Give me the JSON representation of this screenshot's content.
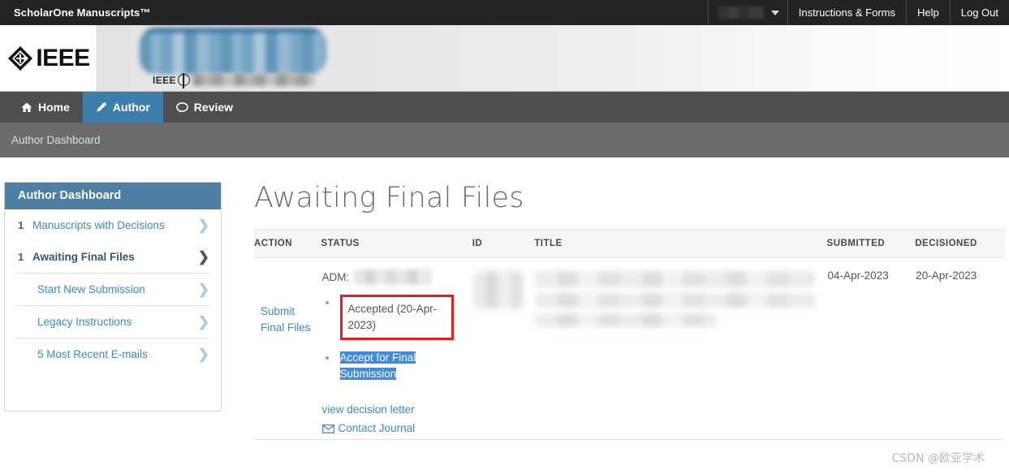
{
  "topbar": {
    "product_title": "ScholarOne Manuscripts™",
    "user_menu_label": "",
    "caret_icon": "chevron-down-icon",
    "links": [
      {
        "label": "Instructions & Forms"
      },
      {
        "label": "Help"
      },
      {
        "label": "Log Out"
      }
    ]
  },
  "banner": {
    "ieee_logo_text": "IEEE",
    "ieee_diamond_icon": "ieee-diamond-icon",
    "journal_logo_alt": "journal-logo-redacted",
    "journal_sub_text": "IEEE",
    "phi_icon": "ieee-phi-icon"
  },
  "nav": {
    "tabs": [
      {
        "label": "Home",
        "icon": "home-icon",
        "active": false
      },
      {
        "label": "Author",
        "icon": "pencil-icon",
        "active": true
      },
      {
        "label": "Review",
        "icon": "speech-bubble-icon",
        "active": false
      }
    ]
  },
  "breadcrumb": {
    "text": "Author Dashboard"
  },
  "sidebar": {
    "header": "Author Dashboard",
    "items": [
      {
        "count": "1",
        "label": "Manuscripts with Decisions",
        "chevron": "chevron-right-icon",
        "active": false
      },
      {
        "count": "1",
        "label": "Awaiting Final Files",
        "chevron": "chevron-right-icon",
        "active": true
      },
      {
        "count": "",
        "label": "Start New Submission",
        "chevron": "chevron-right-icon",
        "active": false
      },
      {
        "count": "",
        "label": "Legacy Instructions",
        "chevron": "chevron-right-icon",
        "active": false
      },
      {
        "count": "",
        "label": "5 Most Recent E-mails",
        "chevron": "chevron-right-icon",
        "active": false
      }
    ]
  },
  "main": {
    "page_title": "Awaiting Final Files",
    "columns": {
      "action": "ACTION",
      "status": "STATUS",
      "id": "ID",
      "title": "TITLE",
      "submitted": "SUBMITTED",
      "decisioned": "DECISIONED"
    },
    "row": {
      "action_link": "Submit Final Files",
      "adm_label": "ADM:",
      "adm_value": "",
      "status_items": [
        {
          "text": "Accepted (20-Apr-2023)",
          "highlight": "red-box"
        },
        {
          "text": "Accept for Final Submission",
          "highlight": "text-selection"
        }
      ],
      "decision_letter_link": "view decision letter",
      "contact_journal_link": "Contact Journal",
      "contact_icon": "envelope-icon",
      "id_value": "",
      "title_value": "",
      "submitted": "04-Apr-2023",
      "decisioned": "20-Apr-2023"
    }
  },
  "watermark": {
    "text": "CSDN @欧亚学术"
  },
  "colors": {
    "topbar_bg": "#232323",
    "nav_bg": "#4f4f4f",
    "nav_active": "#3d7fac",
    "breadcrumb_bg": "#6b6b6b",
    "sidebar_header_bg": "#4d7ea3",
    "link_blue": "#3c8ac4",
    "annotation_red": "#ee1b1b",
    "selection_blue": "#3b8bea"
  }
}
